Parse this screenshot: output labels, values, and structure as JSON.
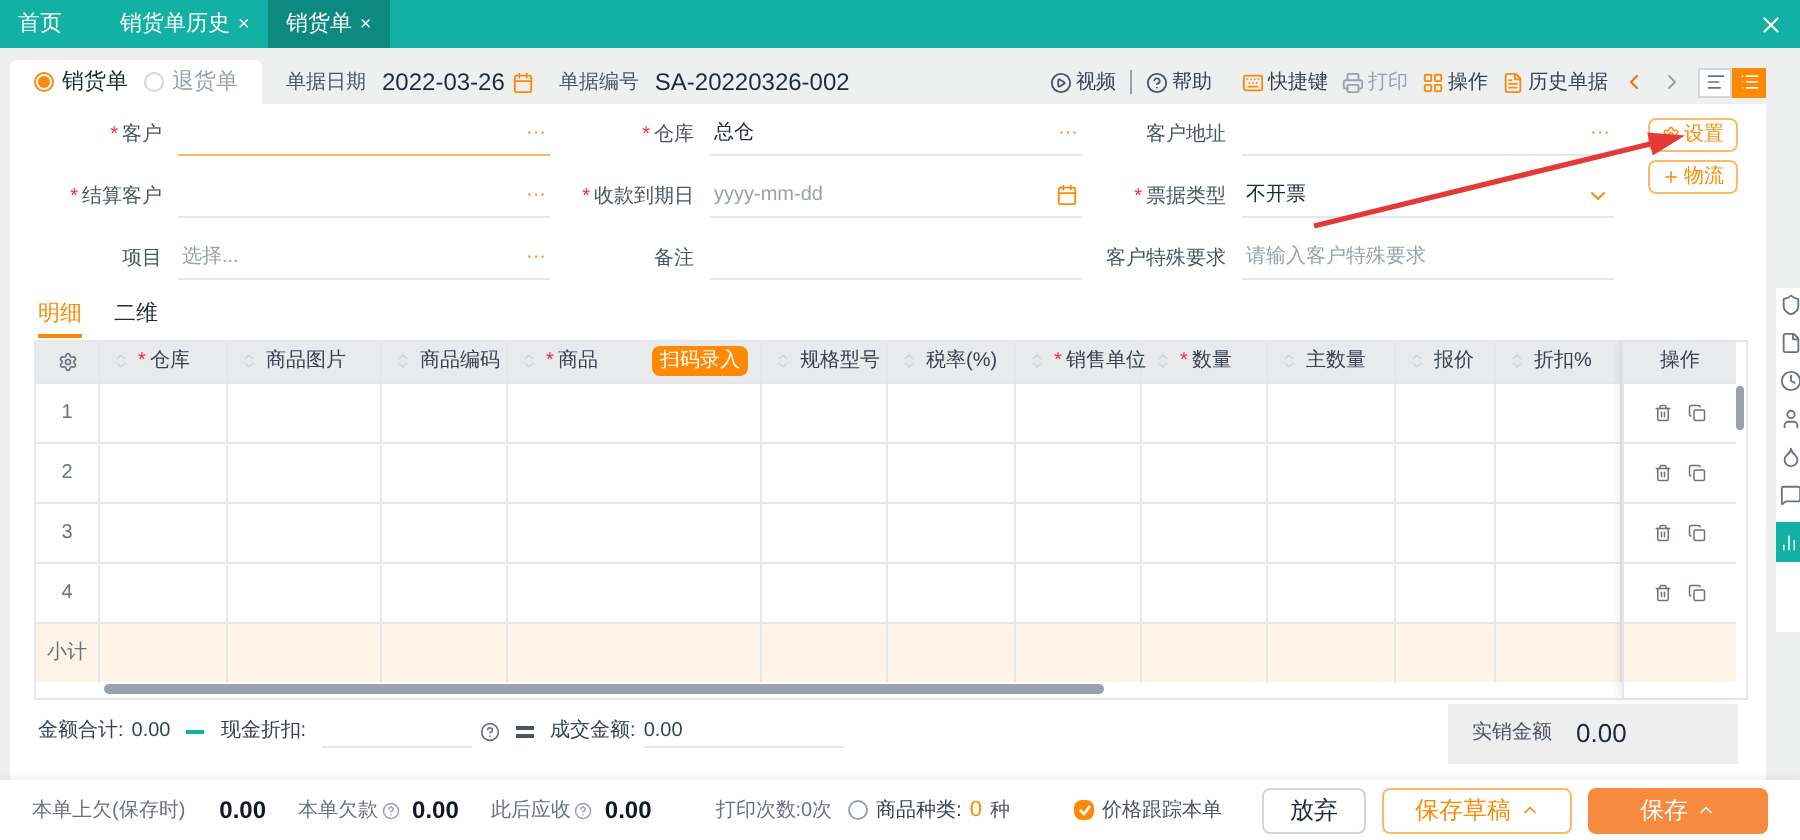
{
  "tabs": [
    {
      "label": "首页",
      "closable": false,
      "selected": false
    },
    {
      "label": "销货单历史",
      "closable": true,
      "selected": false
    },
    {
      "label": "销货单",
      "closable": true,
      "selected": true
    }
  ],
  "close_button": "×",
  "required_mark": "*",
  "more_button": "···",
  "doc_types": [
    {
      "label": "销货单",
      "selected": true
    },
    {
      "label": "退货单",
      "selected": false
    }
  ],
  "doc_date": {
    "label": "单据日期",
    "value": "2022-03-26"
  },
  "doc_number": {
    "label": "单据编号",
    "value": "SA-20220326-002"
  },
  "toolbar": [
    {
      "kind": "video",
      "label": "视频",
      "disabled": false
    },
    {
      "kind": "help",
      "label": "帮助",
      "disabled": false
    },
    {
      "kind": "keyboard",
      "label": "快捷键",
      "disabled": false
    },
    {
      "kind": "print",
      "label": "打印",
      "disabled": true
    },
    {
      "kind": "grid",
      "label": "操作",
      "disabled": false
    },
    {
      "kind": "history",
      "label": "历史单据",
      "disabled": false
    }
  ],
  "view_modes": [
    {
      "kind": "list",
      "selected": false
    },
    {
      "kind": "detail",
      "selected": true
    }
  ],
  "form_rows": [
    [
      {
        "label": "客户",
        "required": true,
        "kind": "lookup",
        "focused": true
      },
      {
        "label": "仓库",
        "required": true,
        "kind": "lookup",
        "value": "总仓",
        "focused": false
      },
      {
        "label": "客户地址",
        "required": false,
        "kind": "lookup",
        "focused": false
      }
    ],
    [
      {
        "label": "结算客户",
        "required": true,
        "kind": "lookup",
        "focused": false
      },
      {
        "label": "收款到期日",
        "required": true,
        "kind": "date",
        "placeholder": "yyyy-mm-dd",
        "focused": false
      },
      {
        "label": "票据类型",
        "required": true,
        "kind": "select",
        "value": "不开票",
        "focused": false
      }
    ],
    [
      {
        "label": "项目",
        "required": false,
        "kind": "lookup",
        "placeholder": "选择...",
        "focused": false
      },
      {
        "label": "备注",
        "required": false,
        "kind": "text",
        "focused": false
      },
      {
        "label": "客户特殊要求",
        "required": false,
        "kind": "text",
        "placeholder": "请输入客户特殊要求",
        "focused": false
      }
    ]
  ],
  "side_buttons": [
    {
      "kind": "settings",
      "label": "设置"
    },
    {
      "kind": "add",
      "label": "物流"
    }
  ],
  "detail_tabs": [
    {
      "label": "明细",
      "selected": true
    },
    {
      "label": "二维",
      "selected": false
    }
  ],
  "table": {
    "columns": [
      {
        "label": "仓库",
        "required": true
      },
      {
        "label": "商品图片",
        "required": false
      },
      {
        "label": "商品编码",
        "required": false
      },
      {
        "label": "商品",
        "required": true,
        "badge": "扫码录入"
      },
      {
        "label": "规格型号",
        "required": false
      },
      {
        "label": "税率(%)",
        "required": false
      },
      {
        "label": "销售单位",
        "required": true
      },
      {
        "label": "数量",
        "required": true
      },
      {
        "label": "主数量",
        "required": false
      },
      {
        "label": "报价",
        "required": false
      },
      {
        "label": "折扣%",
        "required": false
      }
    ],
    "action_column": "操作",
    "rows": [
      "1",
      "2",
      "3",
      "4"
    ],
    "subtotal_label": "小计"
  },
  "summary": {
    "total_label": "金额合计:",
    "total": "0.00",
    "discount_label": "现金折扣:",
    "deal_label": "成交金额:",
    "deal": "0.00"
  },
  "net_sales": {
    "label": "实销金额",
    "value": "0.00"
  },
  "footer": {
    "stats": [
      {
        "label": "本单上欠(保存时)",
        "help": false,
        "value": "0.00"
      },
      {
        "label": "本单欠款",
        "help": true,
        "value": "0.00"
      },
      {
        "label": "此后应收",
        "help": true,
        "value": "0.00"
      }
    ],
    "print_count": "打印次数:0次",
    "kinds": {
      "label": "商品种类:",
      "value": "0",
      "unit": "种",
      "selected": false
    },
    "price_track": {
      "label": "价格跟踪本单",
      "checked": true
    },
    "buttons": [
      {
        "kind": "plain",
        "label": "放弃",
        "menu": false
      },
      {
        "kind": "outline",
        "label": "保存草稿",
        "menu": true
      },
      {
        "kind": "primary",
        "label": "保存",
        "menu": true
      }
    ]
  }
}
